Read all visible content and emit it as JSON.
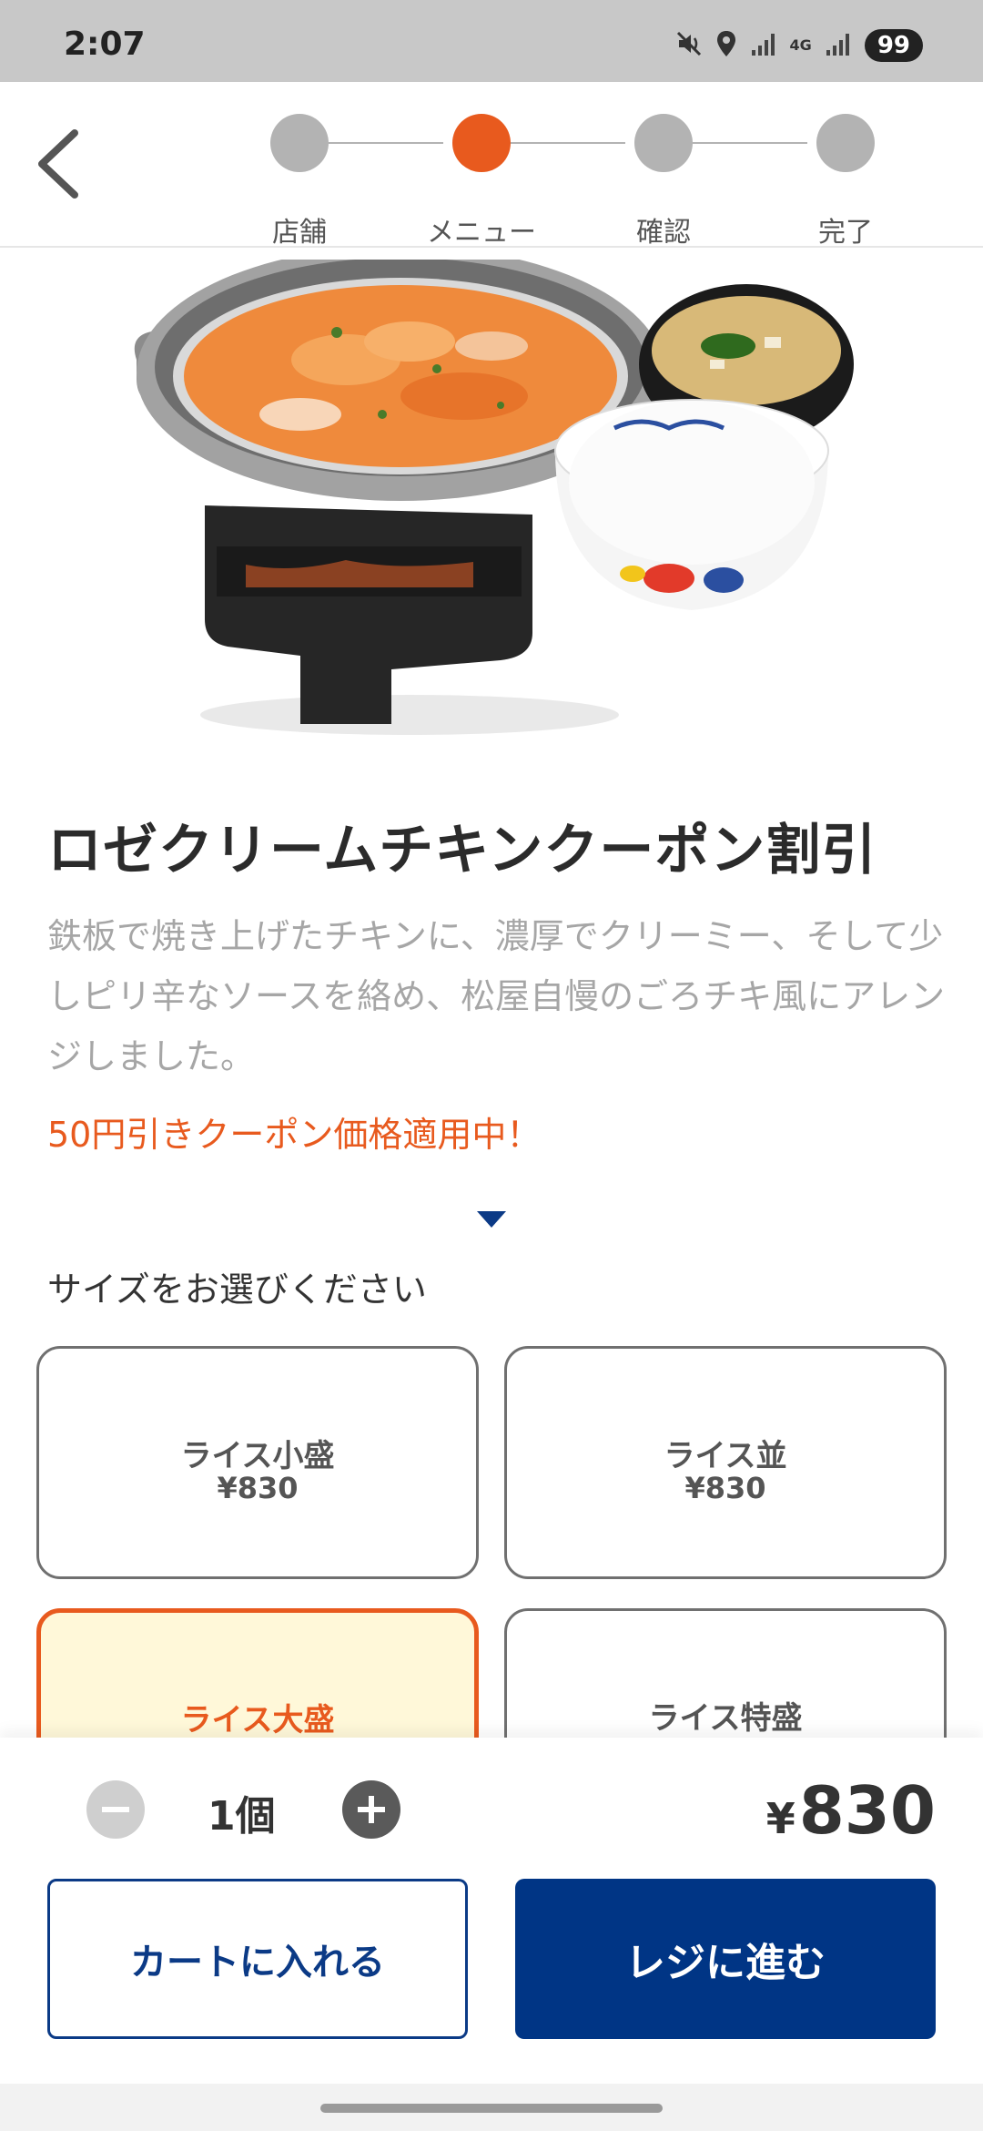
{
  "status_bar": {
    "time": "2:07",
    "network_label": "4G",
    "battery": "99",
    "icons": [
      "mute-vibrate-icon",
      "location-icon",
      "signal-icon",
      "signal-icon",
      "battery-icon"
    ]
  },
  "header": {
    "back_icon": "chevron-left-icon",
    "steps": [
      {
        "label": "店舗",
        "active": false
      },
      {
        "label": "メニュー",
        "active": true
      },
      {
        "label": "確認",
        "active": false
      },
      {
        "label": "完了",
        "active": false
      }
    ]
  },
  "product": {
    "image": "set-meal-photo",
    "title": "ロゼクリームチキンクーポン割引",
    "description": "鉄板で焼き上げたチキンに、濃厚でクリーミー、そして少しピリ辛なソースを絡め、松屋自慢のごろチキ風にアレンジしました。",
    "coupon_note": "50円引きクーポン価格適用中！"
  },
  "size_selector": {
    "heading": "サイズをお選びください",
    "options": [
      {
        "name": "ライス小盛",
        "price": "¥830",
        "selected": false
      },
      {
        "name": "ライス並",
        "price": "¥830",
        "selected": false
      },
      {
        "name": "ライス大盛",
        "price": "",
        "selected": true
      },
      {
        "name": "ライス特盛",
        "price": "",
        "selected": false
      }
    ]
  },
  "order_bar": {
    "quantity": "1個",
    "total_yen": "¥",
    "total_amount": "830",
    "add_to_cart_label": "カートに入れる",
    "checkout_label": "レジに進む"
  },
  "colors": {
    "accent": "#e85a1e",
    "primary": "#003585",
    "selected_bg": "#fff8d9",
    "inactive_step": "#b3b3b3"
  }
}
